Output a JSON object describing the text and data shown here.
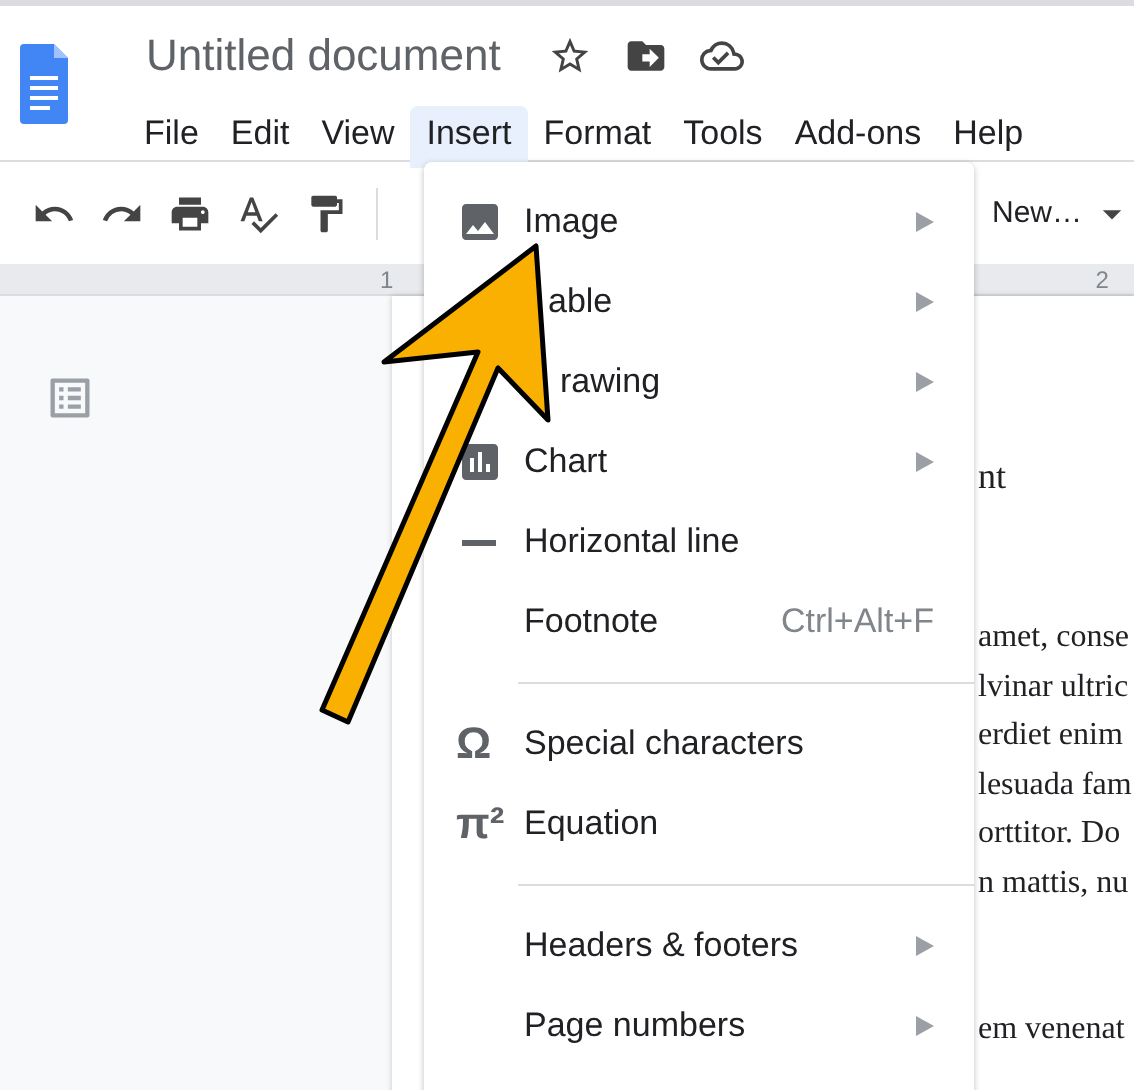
{
  "document_title": "Untitled document",
  "menu_bar": [
    {
      "label": "File",
      "selected": false
    },
    {
      "label": "Edit",
      "selected": false
    },
    {
      "label": "View",
      "selected": false
    },
    {
      "label": "Insert",
      "selected": true
    },
    {
      "label": "Format",
      "selected": false
    },
    {
      "label": "Tools",
      "selected": false
    },
    {
      "label": "Add-ons",
      "selected": false
    },
    {
      "label": "Help",
      "selected": false
    }
  ],
  "toolbar": {
    "font": "New…"
  },
  "ruler": [
    "1",
    "2"
  ],
  "insert_menu": [
    {
      "kind": "image",
      "label": "Image",
      "submenu": true
    },
    {
      "kind": "covered",
      "label": "able",
      "submenu": true
    },
    {
      "kind": "covered",
      "label": "rawing",
      "submenu": true
    },
    {
      "kind": "chart",
      "label": "Chart",
      "submenu": true
    },
    {
      "kind": "line",
      "label": "Horizontal line",
      "submenu": false
    },
    {
      "kind": "plain",
      "label": "Footnote",
      "submenu": false,
      "shortcut": "Ctrl+Alt+F"
    },
    {
      "kind": "divider"
    },
    {
      "kind": "glyph",
      "glyph": "Ω",
      "label": "Special characters",
      "submenu": false
    },
    {
      "kind": "glyph",
      "glyph": "π²",
      "label": "Equation",
      "submenu": false
    },
    {
      "kind": "divider"
    },
    {
      "kind": "plain",
      "label": "Headers & footers",
      "submenu": true
    },
    {
      "kind": "plain",
      "label": "Page numbers",
      "submenu": true
    }
  ],
  "document": {
    "heading": "nt",
    "lines": [
      "amet, conse",
      "lvinar ultric",
      "erdiet enim",
      "lesuada fam",
      "orttitor. Do",
      "n mattis, nu"
    ],
    "last_line": "em venenat"
  }
}
